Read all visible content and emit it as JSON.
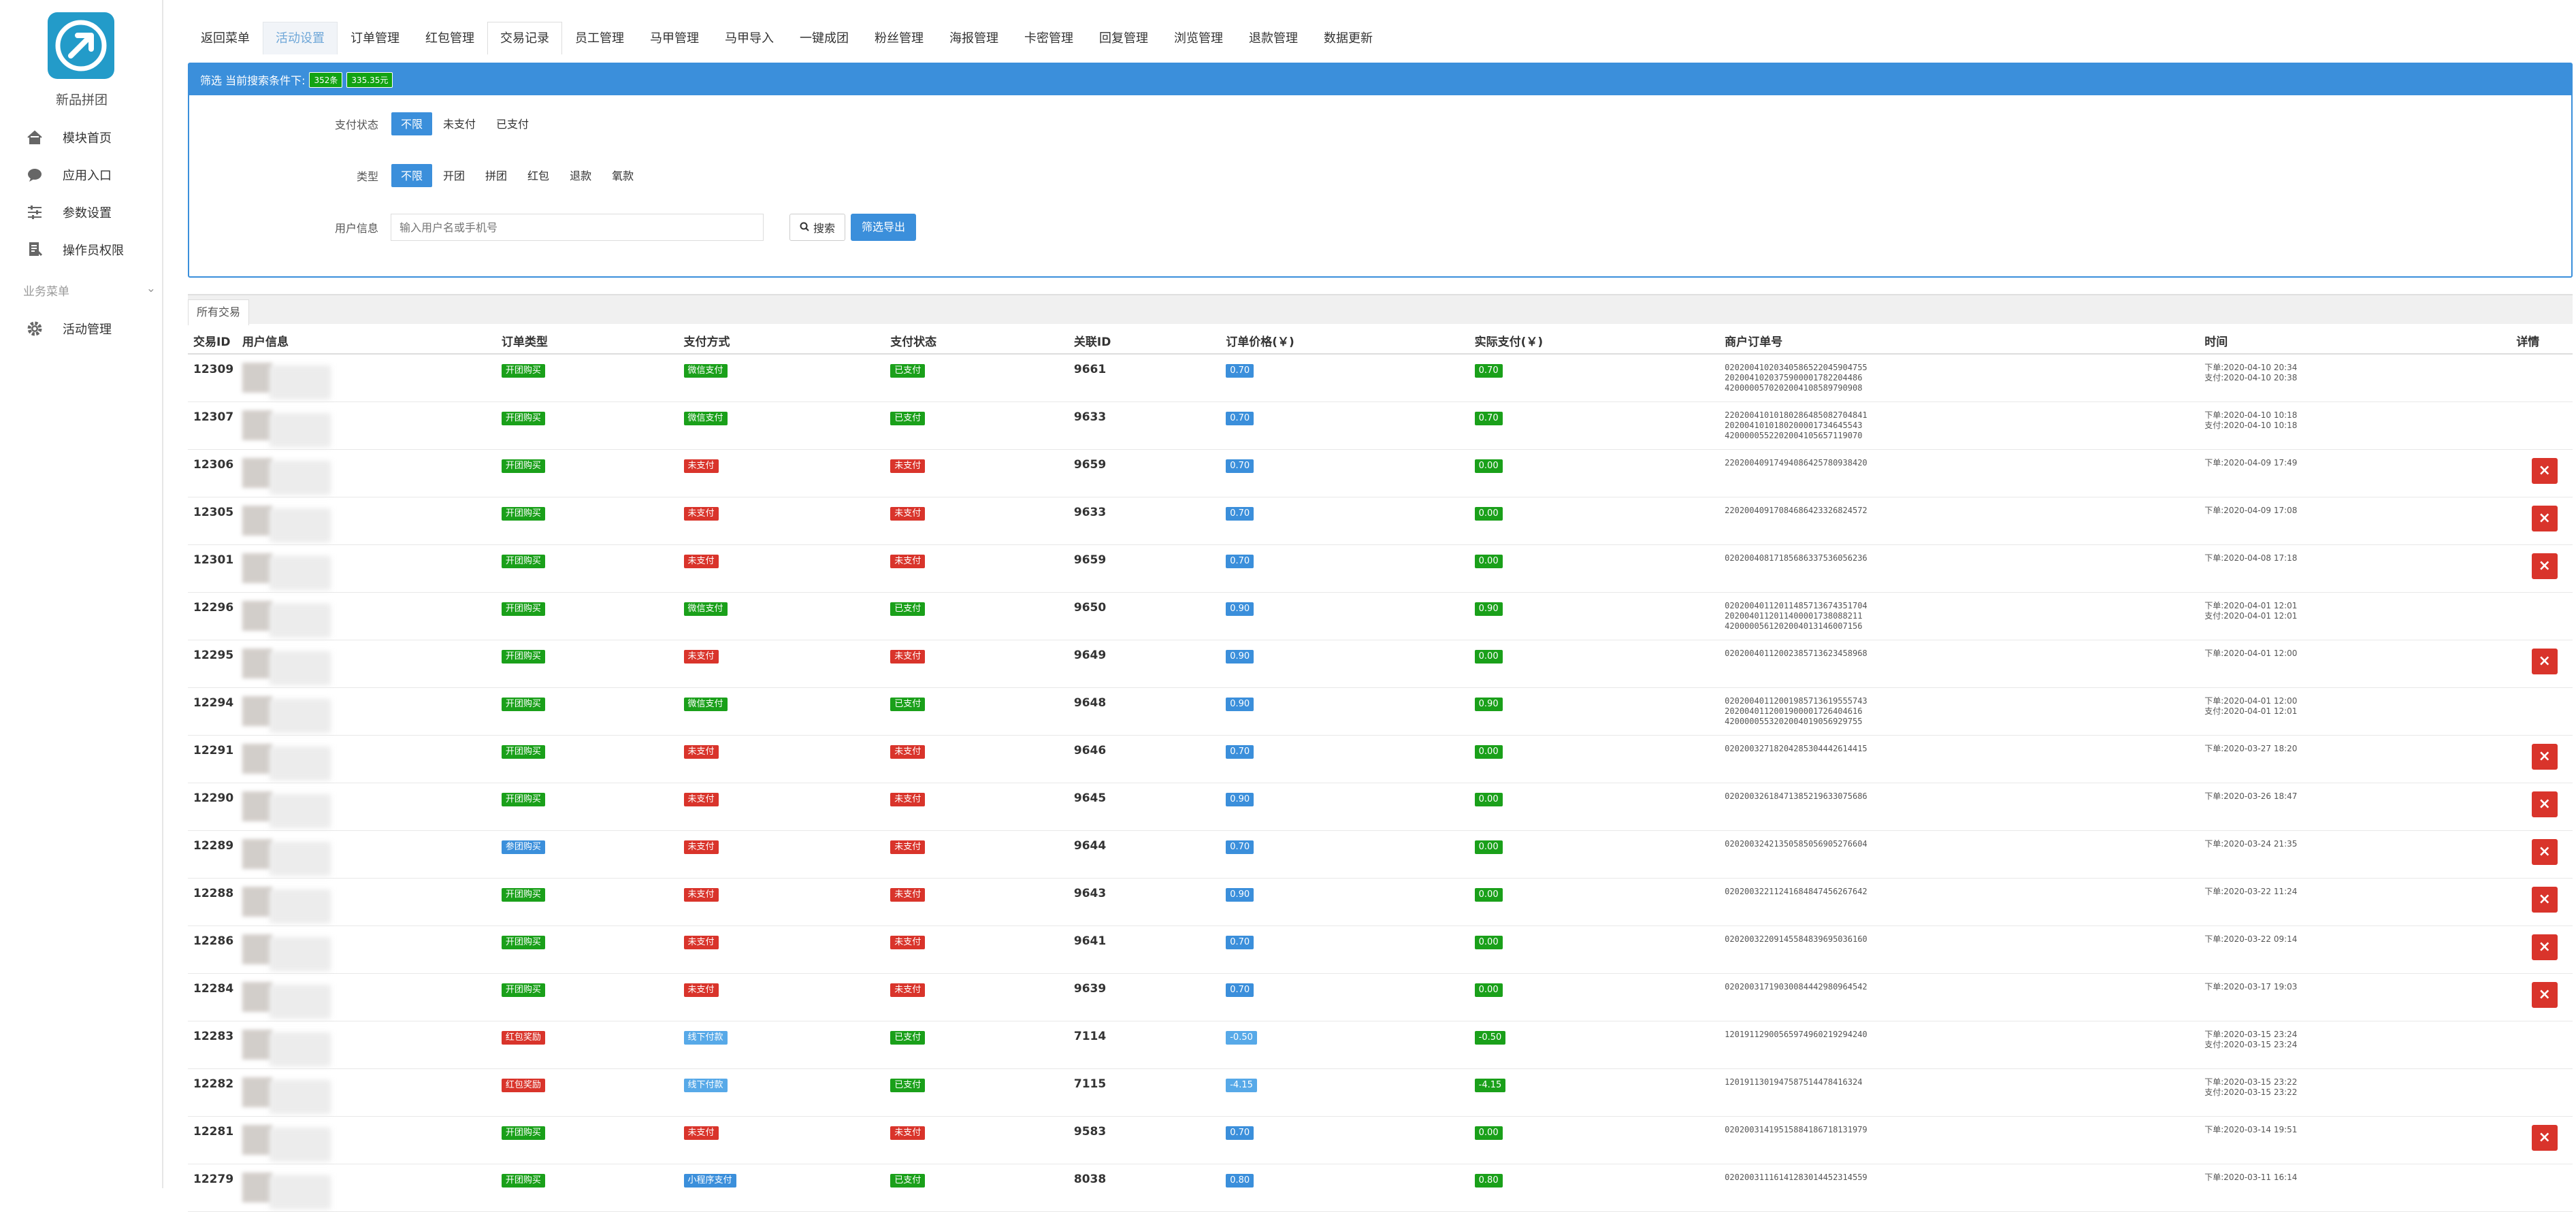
{
  "sidebar": {
    "brand": "新品拼团",
    "items": [
      {
        "label": "模块首页",
        "icon": "home-icon"
      },
      {
        "label": "应用入口",
        "icon": "chat-bubble-icon"
      },
      {
        "label": "参数设置",
        "icon": "sliders-icon"
      },
      {
        "label": "操作员权限",
        "icon": "document-icon"
      }
    ],
    "group_label": "业务菜单",
    "group_items": [
      {
        "label": "活动管理",
        "icon": "gear-icon"
      }
    ]
  },
  "nav": {
    "tabs": [
      "返回菜单",
      "活动设置",
      "订单管理",
      "红包管理",
      "交易记录",
      "员工管理",
      "马甲管理",
      "马甲导入",
      "一键成团",
      "粉丝管理",
      "海报管理",
      "卡密管理",
      "回复管理",
      "浏览管理",
      "退款管理",
      "数据更新"
    ]
  },
  "filter": {
    "title": "筛选 当前搜索条件下:",
    "count_badge": "352条",
    "amount_badge": "335.35元",
    "pay_status_label": "支付状态",
    "pay_status_options": [
      "不限",
      "未支付",
      "已支付"
    ],
    "type_label": "类型",
    "type_options": [
      "不限",
      "开团",
      "拼团",
      "红包",
      "退款",
      "氧款"
    ],
    "user_label": "用户信息",
    "user_placeholder": "输入用户名或手机号",
    "search_label": "搜索",
    "export_label": "筛选导出"
  },
  "all_tab": "所有交易",
  "table": {
    "headers": [
      "交易ID",
      "用户信息",
      "订单类型",
      "支付方式",
      "支付状态",
      "关联ID",
      "订单价格(￥)",
      "实际支付(￥)",
      "商户订单号",
      "时间",
      "详情"
    ],
    "colors": {
      "green": "#1aa01a",
      "red": "#d9342b",
      "blue": "#3b8fdb",
      "lightblue": "#57a9e8"
    },
    "rows": [
      {
        "id": "12309",
        "type": "开团购买",
        "type_c": "green",
        "pay": "微信支付",
        "pay_c": "green",
        "status": "已支付",
        "status_c": "green",
        "rel": "9661",
        "price": "0.70",
        "price_c": "blue",
        "actual": "0.70",
        "actual_c": "green",
        "orders": [
          "020200410203405865220459047​55",
          "2020041020375900001782204486",
          "4200000570202004108589790908"
        ],
        "times": [
          "下单:2020-04-10 20:34",
          "支付:2020-04-10 20:38"
        ],
        "del": false
      },
      {
        "id": "12307",
        "type": "开团购买",
        "type_c": "green",
        "pay": "微信支付",
        "pay_c": "green",
        "status": "已支付",
        "status_c": "green",
        "rel": "9633",
        "price": "0.70",
        "price_c": "blue",
        "actual": "0.70",
        "actual_c": "green",
        "orders": [
          "2202004101018028648508270484​1",
          "2020041010180200001734645543",
          "4200000552202004105657119070"
        ],
        "times": [
          "下单:2020-04-10 10:18",
          "支付:2020-04-10 10:18"
        ],
        "del": false
      },
      {
        "id": "12306",
        "type": "开团购买",
        "type_c": "green",
        "pay": "未支付",
        "pay_c": "red",
        "status": "未支付",
        "status_c": "red",
        "rel": "9659",
        "price": "0.70",
        "price_c": "blue",
        "actual": "0.00",
        "actual_c": "green",
        "orders": [
          "22020040917494086425780938420"
        ],
        "times": [
          "下单:2020-04-09 17:49"
        ],
        "del": true
      },
      {
        "id": "12305",
        "type": "开团购买",
        "type_c": "green",
        "pay": "未支付",
        "pay_c": "red",
        "status": "未支付",
        "status_c": "red",
        "rel": "9633",
        "price": "0.70",
        "price_c": "blue",
        "actual": "0.00",
        "actual_c": "green",
        "orders": [
          "22020040917084686423326824572"
        ],
        "times": [
          "下单:2020-04-09 17:08"
        ],
        "del": true
      },
      {
        "id": "12301",
        "type": "开团购买",
        "type_c": "green",
        "pay": "未支付",
        "pay_c": "red",
        "status": "未支付",
        "status_c": "red",
        "rel": "9659",
        "price": "0.70",
        "price_c": "blue",
        "actual": "0.00",
        "actual_c": "green",
        "orders": [
          "02020040817185686337536056236"
        ],
        "times": [
          "下单:2020-04-08 17:18"
        ],
        "del": true
      },
      {
        "id": "12296",
        "type": "开团购买",
        "type_c": "green",
        "pay": "微信支付",
        "pay_c": "green",
        "status": "已支付",
        "status_c": "green",
        "rel": "9650",
        "price": "0.90",
        "price_c": "blue",
        "actual": "0.90",
        "actual_c": "green",
        "orders": [
          "02020040112011485713674351704",
          "2020040112011400001738088211",
          "4200000561202004013146007156"
        ],
        "times": [
          "下单:2020-04-01 12:01",
          "支付:2020-04-01 12:01"
        ],
        "del": false
      },
      {
        "id": "12295",
        "type": "开团购买",
        "type_c": "green",
        "pay": "未支付",
        "pay_c": "red",
        "status": "未支付",
        "status_c": "red",
        "rel": "9649",
        "price": "0.90",
        "price_c": "blue",
        "actual": "0.00",
        "actual_c": "green",
        "orders": [
          "02020040112002385713623458968"
        ],
        "times": [
          "下单:2020-04-01 12:00"
        ],
        "del": true
      },
      {
        "id": "12294",
        "type": "开团购买",
        "type_c": "green",
        "pay": "微信支付",
        "pay_c": "green",
        "status": "已支付",
        "status_c": "green",
        "rel": "9648",
        "price": "0.90",
        "price_c": "blue",
        "actual": "0.90",
        "actual_c": "green",
        "orders": [
          "02020040112001985713619555743",
          "2020040112001900001726404616",
          "4200000553202004019056929755"
        ],
        "times": [
          "下单:2020-04-01 12:00",
          "支付:2020-04-01 12:01"
        ],
        "del": false
      },
      {
        "id": "12291",
        "type": "开团购买",
        "type_c": "green",
        "pay": "未支付",
        "pay_c": "red",
        "status": "未支付",
        "status_c": "red",
        "rel": "9646",
        "price": "0.70",
        "price_c": "blue",
        "actual": "0.00",
        "actual_c": "green",
        "orders": [
          "02020032718204285304442614415"
        ],
        "times": [
          "下单:2020-03-27 18:20"
        ],
        "del": true
      },
      {
        "id": "12290",
        "type": "开团购买",
        "type_c": "green",
        "pay": "未支付",
        "pay_c": "red",
        "status": "未支付",
        "status_c": "red",
        "rel": "9645",
        "price": "0.90",
        "price_c": "blue",
        "actual": "0.00",
        "actual_c": "green",
        "orders": [
          "02020032618471385219633075686"
        ],
        "times": [
          "下单:2020-03-26 18:47"
        ],
        "del": true
      },
      {
        "id": "12289",
        "type": "参团购买",
        "type_c": "blue",
        "pay": "未支付",
        "pay_c": "red",
        "status": "未支付",
        "status_c": "red",
        "rel": "9644",
        "price": "0.70",
        "price_c": "blue",
        "actual": "0.00",
        "actual_c": "green",
        "orders": [
          "02020032421350585056905276604"
        ],
        "times": [
          "下单:2020-03-24 21:35"
        ],
        "del": true
      },
      {
        "id": "12288",
        "type": "开团购买",
        "type_c": "green",
        "pay": "未支付",
        "pay_c": "red",
        "status": "未支付",
        "status_c": "red",
        "rel": "9643",
        "price": "0.90",
        "price_c": "blue",
        "actual": "0.00",
        "actual_c": "green",
        "orders": [
          "02020032211241684847456267642"
        ],
        "times": [
          "下单:2020-03-22 11:24"
        ],
        "del": true
      },
      {
        "id": "12286",
        "type": "开团购买",
        "type_c": "green",
        "pay": "未支付",
        "pay_c": "red",
        "status": "未支付",
        "status_c": "red",
        "rel": "9641",
        "price": "0.70",
        "price_c": "blue",
        "actual": "0.00",
        "actual_c": "green",
        "orders": [
          "02020032209145584839695036160"
        ],
        "times": [
          "下单:2020-03-22 09:14"
        ],
        "del": true
      },
      {
        "id": "12284",
        "type": "开团购买",
        "type_c": "green",
        "pay": "未支付",
        "pay_c": "red",
        "status": "未支付",
        "status_c": "red",
        "rel": "9639",
        "price": "0.70",
        "price_c": "blue",
        "actual": "0.00",
        "actual_c": "green",
        "orders": [
          "02020031719030084442980964542"
        ],
        "times": [
          "下单:2020-03-17 19:03"
        ],
        "del": true
      },
      {
        "id": "12283",
        "type": "红包奖励",
        "type_c": "red",
        "pay": "线下付款",
        "pay_c": "lightblue",
        "status": "已支付",
        "status_c": "green",
        "rel": "7114",
        "price": "-0.50",
        "price_c": "lightblue",
        "actual": "-0.50",
        "actual_c": "green",
        "orders": [
          "12019112900565974960219294240"
        ],
        "times": [
          "下单:2020-03-15 23:24",
          "支付:2020-03-15 23:24"
        ],
        "del": false
      },
      {
        "id": "12282",
        "type": "红包奖励",
        "type_c": "red",
        "pay": "线下付款",
        "pay_c": "lightblue",
        "status": "已支付",
        "status_c": "green",
        "rel": "7115",
        "price": "-4.15",
        "price_c": "lightblue",
        "actual": "-4.15",
        "actual_c": "green",
        "orders": [
          "12019113019475875144784​16324"
        ],
        "times": [
          "下单:2020-03-15 23:22",
          "支付:2020-03-15 23:22"
        ],
        "del": false
      },
      {
        "id": "12281",
        "type": "开团购买",
        "type_c": "green",
        "pay": "未支付",
        "pay_c": "red",
        "status": "未支付",
        "status_c": "red",
        "rel": "9583",
        "price": "0.70",
        "price_c": "blue",
        "actual": "0.00",
        "actual_c": "green",
        "orders": [
          "02020031419515884186718131979"
        ],
        "times": [
          "下单:2020-03-14 19:51"
        ],
        "del": true
      },
      {
        "id": "12279",
        "type": "开团购买",
        "type_c": "green",
        "pay": "小程序支付",
        "pay_c": "blue",
        "status": "已支付",
        "status_c": "green",
        "rel": "8038",
        "price": "0.80",
        "price_c": "blue",
        "actual": "0.80",
        "actual_c": "green",
        "orders": [
          "02020031116141283014452314559"
        ],
        "times": [
          "下单:2020-03-11 16:14"
        ],
        "del": false
      }
    ]
  }
}
